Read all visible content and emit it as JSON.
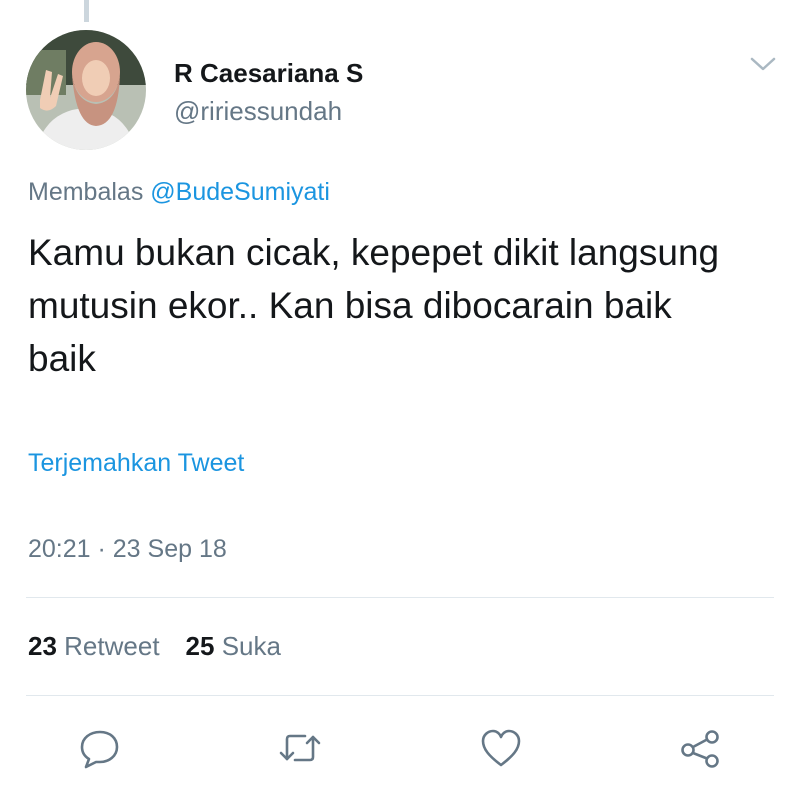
{
  "user": {
    "display_name": "R Caesariana S",
    "handle": "@ririessundah"
  },
  "tweet": {
    "reply_prefix": "Membalas",
    "reply_to": "@BudeSumiyati",
    "text": "Kamu bukan cicak, kepepet dikit langsung mutusin ekor.. Kan bisa dibocarain baik baik",
    "translate_label": "Terjemahkan Tweet",
    "timestamp": "20:21 · 23 Sep 18"
  },
  "stats": {
    "retweet_count": "23",
    "retweet_label": "Retweet",
    "like_count": "25",
    "like_label": "Suka"
  },
  "icons": {
    "reply": "reply-icon",
    "retweet": "retweet-icon",
    "like": "heart-icon",
    "share": "share-icon",
    "menu": "chevron-down-icon"
  },
  "colors": {
    "link": "#1b95e0",
    "secondary_text": "#657786",
    "primary_text": "#14171a",
    "divider": "#e1e8ed"
  }
}
